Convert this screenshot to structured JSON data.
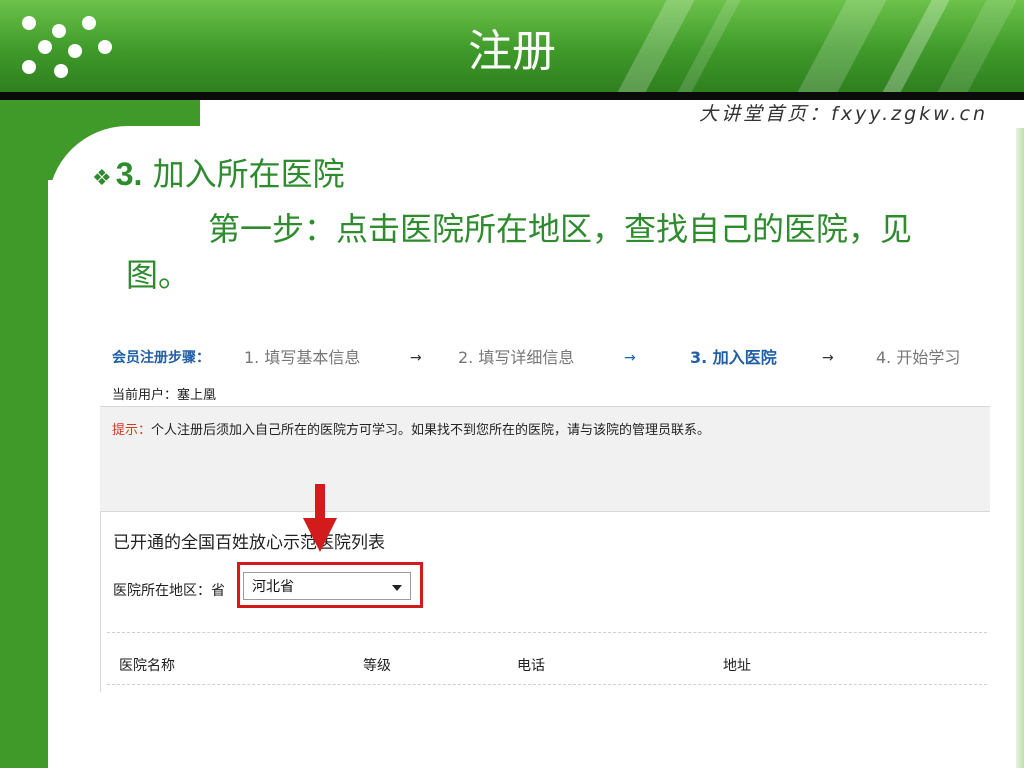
{
  "slide": {
    "title": "注册",
    "site_label": "大讲堂首页：fxyy.zgkw.cn",
    "bullet_number": "3.",
    "bullet_text": "加入所在医院",
    "paragraph": "第一步：点击医院所在地区，查找自己的医院，见图。"
  },
  "screenshot": {
    "steps_label": "会员注册步骤：",
    "steps": [
      "1. 填写基本信息",
      "2. 填写详细信息",
      "3. 加入医院",
      "4. 开始学习"
    ],
    "current_step_index": 2,
    "arrow": "→",
    "current_user_label": "当前用户：",
    "current_user": "塞上凰",
    "tip_label": "提示：",
    "tip_text": "个人注册后须加入自己所在的医院方可学习。如果找不到您所在的医院，请与该院的管理员联系。",
    "list_title": "已开通的全国百姓放心示范医院列表",
    "region_label": "医院所在地区：省",
    "region_selected": "河北省",
    "table_headers": [
      "医院名称",
      "等级",
      "电话",
      "地址"
    ]
  },
  "colors": {
    "header_green": "#3f9a2a",
    "slide_text_green": "#2e8b2e",
    "step_blue": "#1f5fa8",
    "tip_red": "#d03a1f",
    "highlight_red": "#d41b1b"
  },
  "icons": {
    "bullet": "diamond-four-bullet",
    "arrow_annotation": "red-down-arrow",
    "select_caret": "caret-down"
  }
}
